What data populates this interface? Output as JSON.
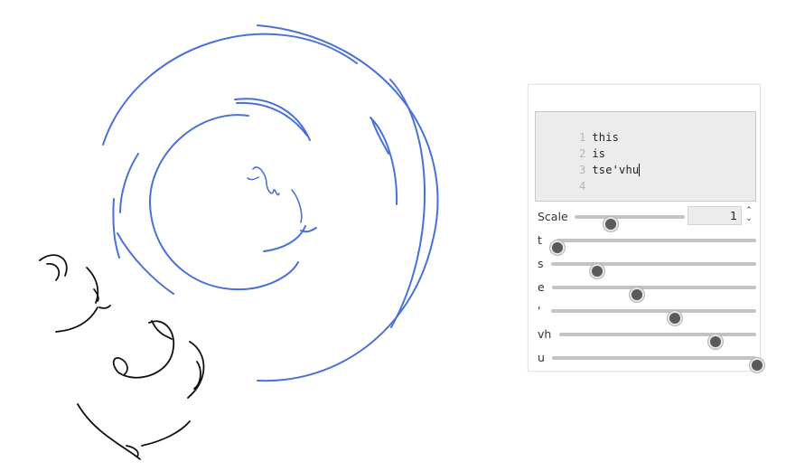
{
  "editor": {
    "lines": [
      {
        "number": "1",
        "text": "this"
      },
      {
        "number": "2",
        "text": "is"
      },
      {
        "number": "3",
        "text": "tse'vhu"
      },
      {
        "number": "4",
        "text": ""
      }
    ]
  },
  "controls": {
    "scale": {
      "label": "Scale",
      "value": "1",
      "slider_fraction": 0.32
    },
    "sliders": [
      {
        "label": "t",
        "fraction": 0.0
      },
      {
        "label": "s",
        "fraction": 0.22
      },
      {
        "label": "e",
        "fraction": 0.41
      },
      {
        "label": "'",
        "fraction": 0.6
      },
      {
        "label": "vh",
        "fraction": 0.79
      },
      {
        "label": "u",
        "fraction": 1.0
      }
    ]
  },
  "colors": {
    "blue_stroke": "#4a72d6",
    "black_stroke": "#111111",
    "panel_border": "#e3e3e3",
    "editor_background": "#ececec"
  }
}
